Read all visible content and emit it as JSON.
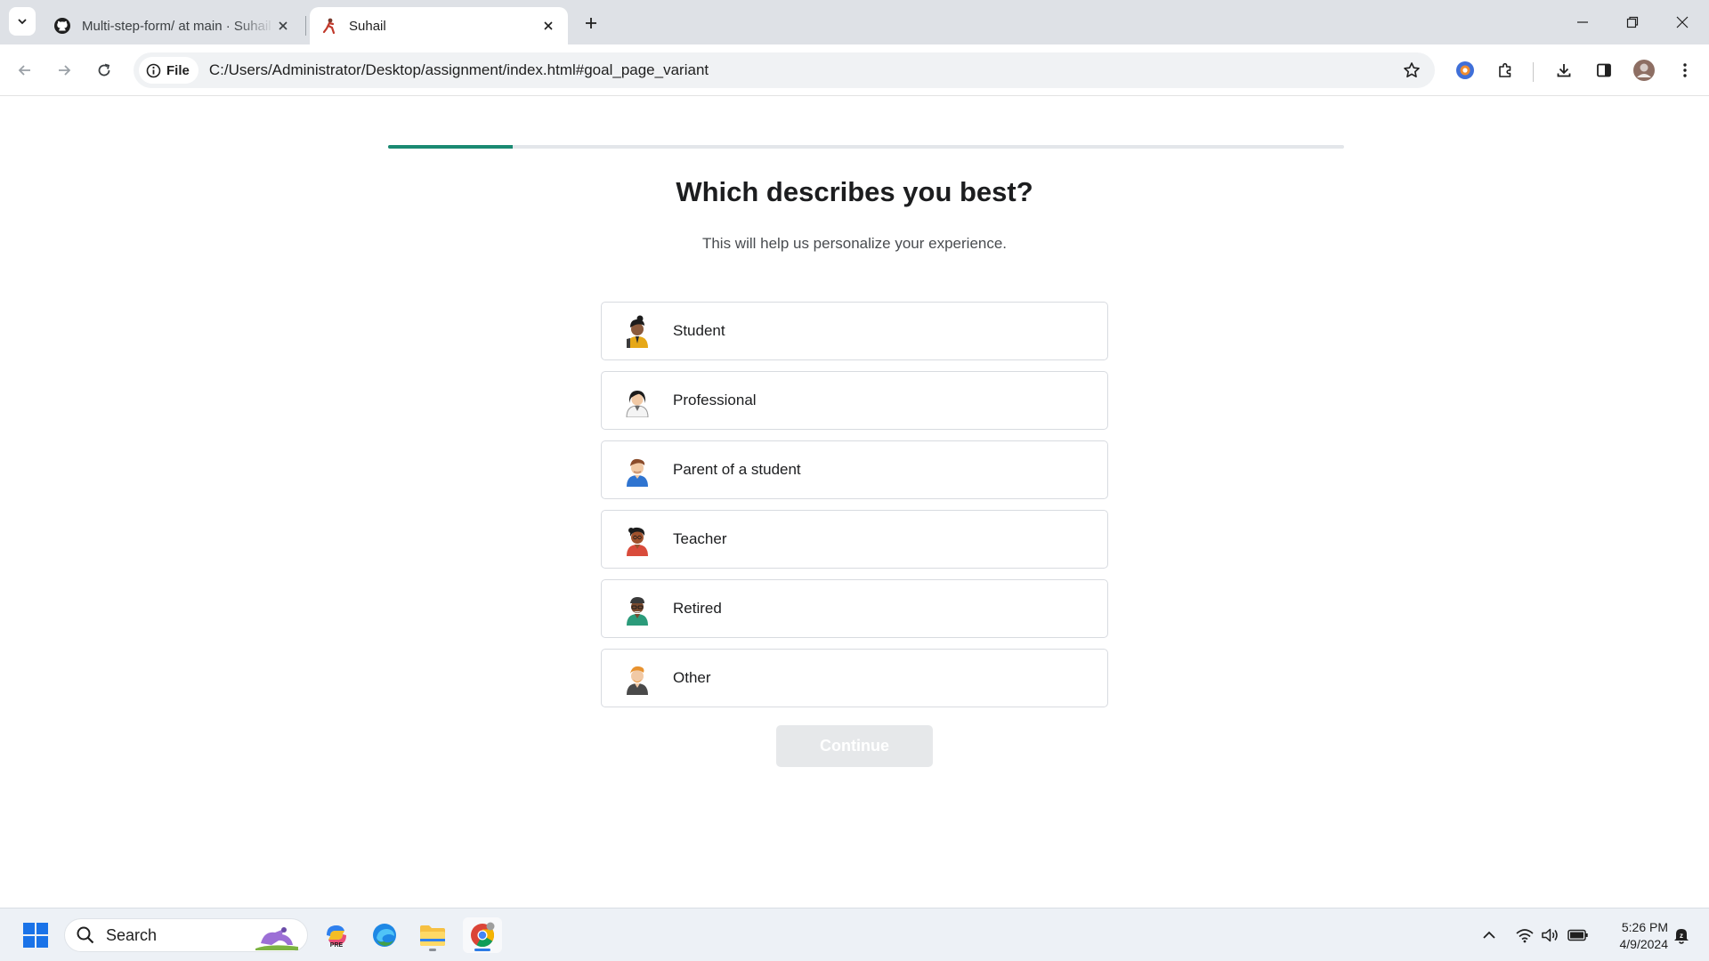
{
  "browser": {
    "tabs": [
      {
        "title": "Multi-step-form/ at main · Suhail",
        "favicon": "github-icon",
        "active": false
      },
      {
        "title": "Suhail",
        "favicon": "site-favicon",
        "active": true
      }
    ],
    "omnibox": {
      "chip_label": "File",
      "url": "C:/Users/Administrator/Desktop/assignment/index.html#goal_page_variant"
    }
  },
  "page": {
    "progress_fraction": 0.13,
    "progress_color": "#1a8a72",
    "heading": "Which describes you best?",
    "subtitle": "This will help us personalize your experience.",
    "options": [
      {
        "label": "Student",
        "avatar": "student-avatar-icon"
      },
      {
        "label": "Professional",
        "avatar": "professional-avatar-icon"
      },
      {
        "label": "Parent of a student",
        "avatar": "parent-avatar-icon"
      },
      {
        "label": "Teacher",
        "avatar": "teacher-avatar-icon"
      },
      {
        "label": "Retired",
        "avatar": "retired-avatar-icon"
      },
      {
        "label": "Other",
        "avatar": "other-avatar-icon"
      }
    ],
    "continue_label": "Continue",
    "continue_enabled": false
  },
  "taskbar": {
    "search_label": "Search",
    "time": "5:26 PM",
    "date": "4/9/2024"
  }
}
